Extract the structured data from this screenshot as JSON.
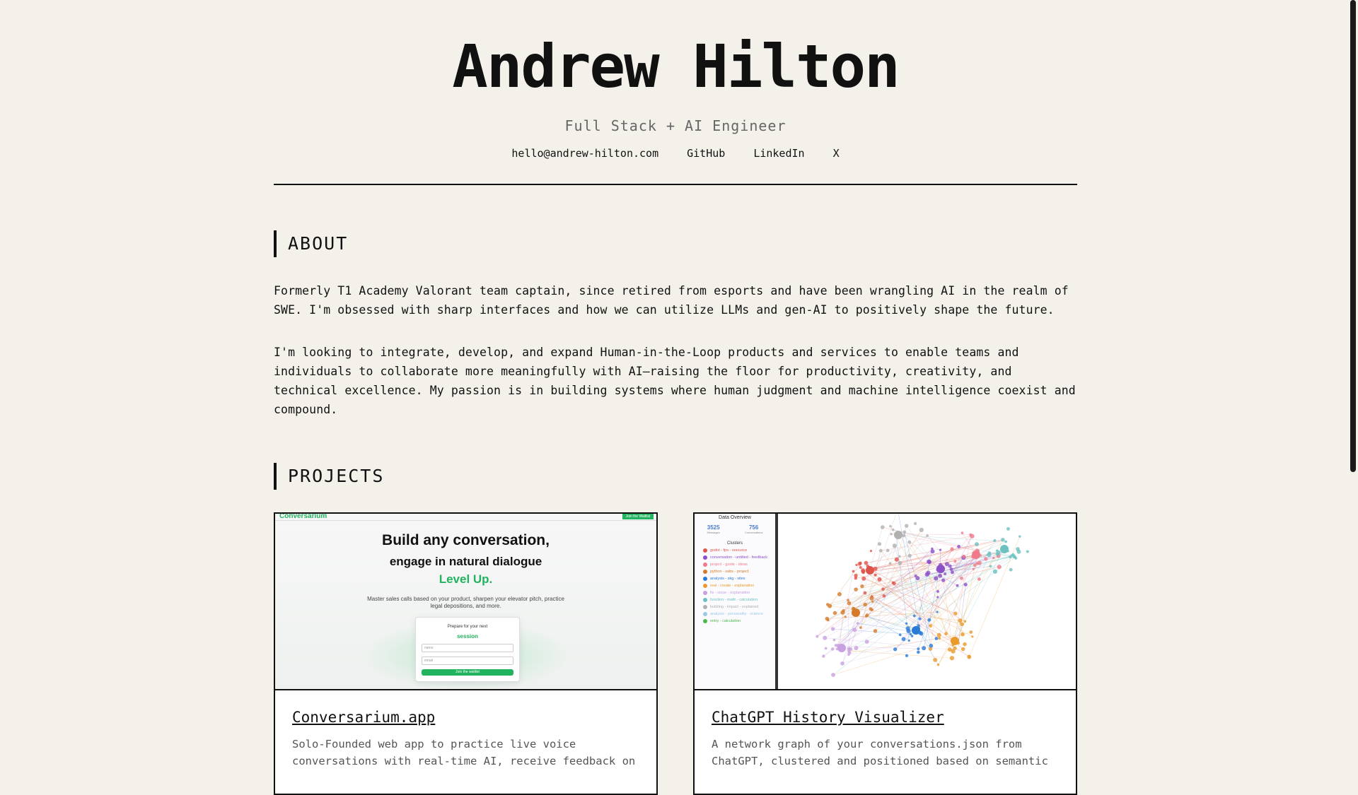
{
  "header": {
    "name": "Andrew Hilton",
    "subtitle": "Full Stack + AI Engineer",
    "links": [
      "hello@andrew-hilton.com",
      "GitHub",
      "LinkedIn",
      "X"
    ]
  },
  "about": {
    "heading": "ABOUT",
    "paragraphs": [
      "Formerly T1 Academy Valorant team captain, since retired from esports and have been wrangling AI in the realm of SWE. I'm obsessed with sharp interfaces and how we can utilize LLMs and gen-AI to positively shape the future.",
      "I'm looking to integrate, develop, and expand Human-in-the-Loop products and services to enable teams and individuals to collaborate more meaningfully with AI—raising the floor for productivity, creativity, and technical excellence. My passion is in building systems where human judgment and machine intelligence coexist and compound."
    ]
  },
  "projects": {
    "heading": "PROJECTS",
    "items": [
      {
        "title": "Conversarium.app",
        "desc": "Solo-Founded web app to practice live voice conversations with real-time AI, receive feedback on",
        "preview": {
          "logo": "Conversarium",
          "cta": "Join the Waitlist",
          "headline": "Build any conversation,",
          "headline2": "engage in natural dialogue",
          "headline3": "Level Up.",
          "sub": "Master sales calls based on your product, sharpen your elevator pitch, practice legal depositions, and more.",
          "box_title": "Prepare for your next",
          "box_word": "session",
          "field_name": "name",
          "field_email": "email",
          "button": "Join the waitlist"
        }
      },
      {
        "title": "ChatGPT History Visualizer",
        "desc": "A network graph of your conversations.json from ChatGPT, clustered and positioned based on semantic",
        "preview": {
          "overview": "Data Overview",
          "stats": [
            {
              "value": "3525",
              "label": "Messages"
            },
            {
              "value": "756",
              "label": "Conversations"
            }
          ],
          "clusters_title": "Clusters",
          "clusters": [
            {
              "label": "godot - fps - resource",
              "color": "#e0534a"
            },
            {
              "label": "conversation - untitled - feedback",
              "color": "#8b4fc8"
            },
            {
              "label": "project - guide - ideas",
              "color": "#f07a8a"
            },
            {
              "label": "python - sabs - project",
              "color": "#d47a2a"
            },
            {
              "label": "analysis - skg - sites",
              "color": "#2b7bd6"
            },
            {
              "label": "real - create - explanation",
              "color": "#e89a2a"
            },
            {
              "label": "fix - issue - explanation",
              "color": "#c9a0e0"
            },
            {
              "label": "function - math - calculation",
              "color": "#6cc0c0"
            },
            {
              "label": "building - impact - explained",
              "color": "#b0b0b0"
            },
            {
              "label": "analysis - personality - science",
              "color": "#9cc8e8"
            },
            {
              "label": "entry - calculation",
              "color": "#4cb84c"
            }
          ]
        }
      }
    ]
  },
  "colors": {
    "background": "#f3f1ea",
    "text": "#111111",
    "muted": "#666666",
    "accent_green": "#22b35e"
  }
}
